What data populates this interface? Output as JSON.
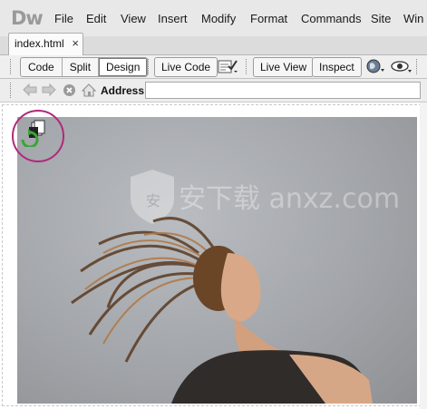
{
  "app": {
    "logo": "Dw"
  },
  "menu": [
    "File",
    "Edit",
    "View",
    "Insert",
    "Modify",
    "Format",
    "Commands",
    "Site",
    "Win"
  ],
  "document_tab": {
    "label": "index.html",
    "close_glyph": "×"
  },
  "toolbar": {
    "view_modes": [
      "Code",
      "Split",
      "Design"
    ],
    "active_view": "Design",
    "live_code": "Live Code",
    "live_view": "Live View",
    "inspect": "Inspect",
    "icons": [
      "check-page-icon",
      "globe-icon",
      "eye-options-icon"
    ]
  },
  "address_bar": {
    "label": "Address:",
    "value": "",
    "icons": [
      "back-arrow-icon",
      "forward-arrow-icon",
      "stop-icon",
      "home-icon"
    ]
  },
  "design_view": {
    "image_content": "photo of woman with flowing hair",
    "watermark": "安下载 anxz.com",
    "highlight_color": "#b02a7a",
    "icon": "related-files-sync-icon"
  }
}
